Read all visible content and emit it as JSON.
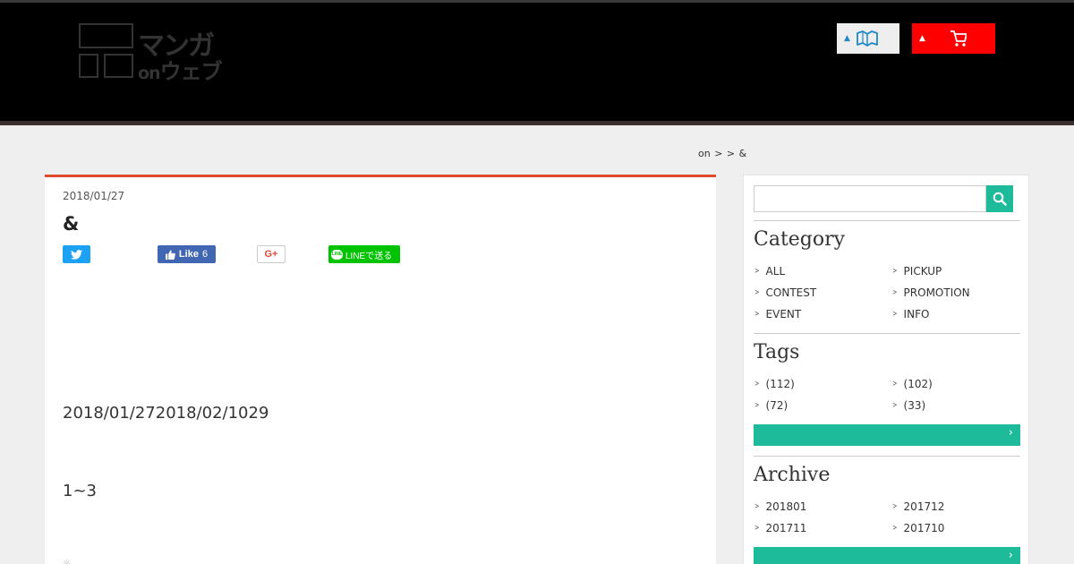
{
  "header": {
    "logo": {
      "line1": "マンガ",
      "on": "on",
      "line2": "ウェブ"
    },
    "buttons": [
      {
        "name": "read",
        "bg": "#eeeeee",
        "icon": "book-icon"
      },
      {
        "name": "cart",
        "bg": "#ff0000",
        "icon": "cart-icon"
      }
    ]
  },
  "breadcrumb": {
    "text": "on >  > &"
  },
  "article": {
    "date": "2018/01/27",
    "title": "&",
    "share": {
      "facebook_label": "Like",
      "facebook_count": "6",
      "google_label": "G+",
      "line_label": "LINEで送る"
    },
    "paragraphs": [
      "2018/01/272018/02/1029",
      "1~3"
    ],
    "footer_peek": "※"
  },
  "sidebar": {
    "search": {
      "placeholder": ""
    },
    "category": {
      "title": "Category",
      "items": [
        "ALL",
        "PICKUP",
        "CONTEST",
        "PROMOTION",
        "EVENT",
        "INFO"
      ]
    },
    "tags": {
      "title": "Tags",
      "items": [
        "(112)",
        "(102)",
        "(72)",
        "(33)"
      ]
    },
    "archive": {
      "title": "Archive",
      "items": [
        "201801",
        "201712",
        "201711",
        "201710"
      ]
    }
  },
  "colors": {
    "accent": "#1dbb9a",
    "article_top": "#e04b2d",
    "header_bg": "#000000"
  }
}
